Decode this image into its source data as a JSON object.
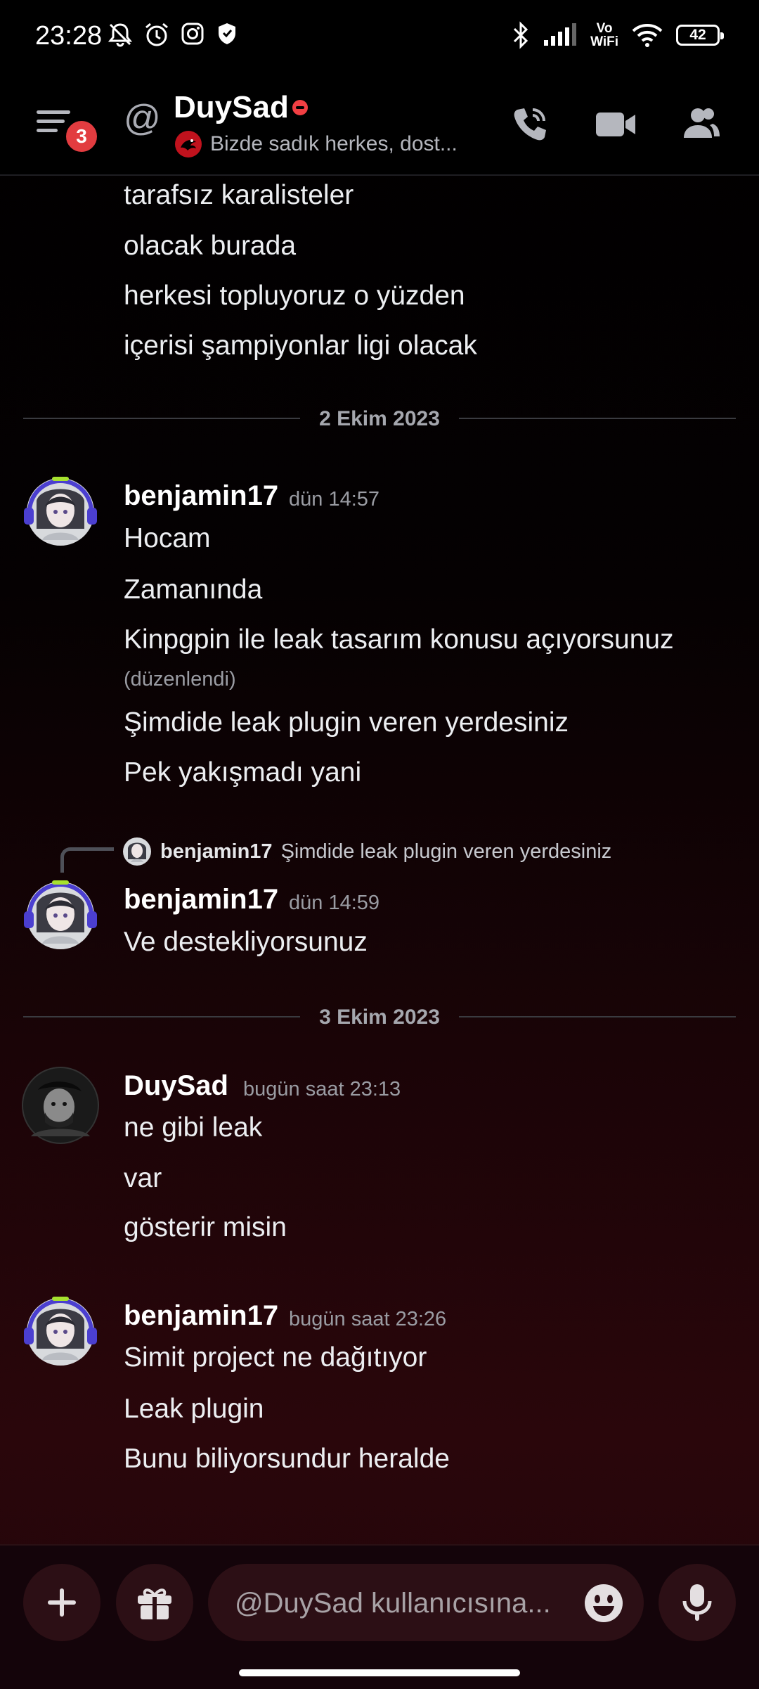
{
  "status_bar": {
    "time": "23:28",
    "vowifi_top": "Vo",
    "vowifi_bottom": "WiFi",
    "battery": "42",
    "icons": [
      "bell-off-icon",
      "alarm-icon",
      "instagram-icon",
      "shield-icon",
      "bluetooth-icon",
      "signal-icon",
      "wifi-icon",
      "battery-icon"
    ]
  },
  "header": {
    "unread_badge": "3",
    "at_symbol": "@",
    "name": "DuySad",
    "status_text": "Bizde sadık herkes, dost...",
    "icons": [
      "menu-icon",
      "voice-call-icon",
      "video-call-icon",
      "members-icon"
    ],
    "dnd_color": "#f23f43"
  },
  "messages": {
    "top_lines": [
      "tarafsız karalisteler",
      "olacak burada",
      "herkesi topluyoruz o yüzden",
      "içerisi şampiyonlar ligi olacak"
    ],
    "date_1": "2 Ekim 2023",
    "g1": {
      "author": "benjamin17",
      "time": "dün 14:57",
      "lines": [
        "Hocam",
        "Zamanında",
        "Kinpgpin ile leak tasarım konusu açıyorsunuz",
        "Şimdide leak plugin veren yerdesiniz",
        "Pek yakışmadı yani"
      ],
      "edited": "(düzenlendi)"
    },
    "reply": {
      "author": "benjamin17",
      "text": "Şimdide leak plugin veren yerdesiniz"
    },
    "g2": {
      "author": "benjamin17",
      "time": "dün 14:59",
      "lines": [
        "Ve destekliyorsunuz"
      ]
    },
    "date_2": "3 Ekim 2023",
    "g3": {
      "author": "DuySad",
      "time": "bugün saat 23:13",
      "lines": [
        "ne gibi leak",
        "var",
        "gösterir misin"
      ]
    },
    "g4": {
      "author": "benjamin17",
      "time": "bugün saat 23:26",
      "lines": [
        "Simit project ne dağıtıyor",
        "Leak plugin",
        "Bunu biliyorsundur heralde"
      ]
    }
  },
  "composer": {
    "placeholder": "@DuySad kullanıcısına...",
    "icons": [
      "plus-icon",
      "gift-icon",
      "emoji-icon",
      "microphone-icon"
    ]
  },
  "colors": {
    "accent_red": "#e23c40",
    "bubble_bg": "#2c0f15"
  }
}
